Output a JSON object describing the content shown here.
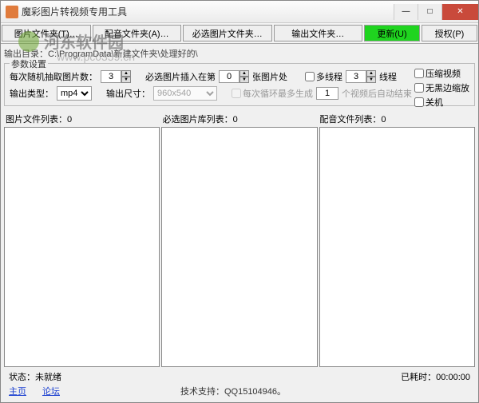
{
  "window": {
    "title": "魔彩图片转视频专用工具"
  },
  "titlebar_buttons": {
    "min": "—",
    "max": "□",
    "close": "✕"
  },
  "toolbar": {
    "btn1": "图片文件夹(T)…",
    "btn2": "配音文件夹(A)…",
    "btn3": "必选图片文件夹…",
    "btn4": "输出文件夹…",
    "btn5": "更新(U)",
    "btn6": "授权(P)"
  },
  "output_path": {
    "label": "输出目录：",
    "value": "C:\\ProgramData\\新建文件夹\\处理好的\\"
  },
  "params": {
    "legend": "参数设置",
    "row1": {
      "random_label": "每次随机抽取图片数：",
      "random_value": "3",
      "insert_label_a": "必选图片插入在第",
      "insert_value": "0",
      "insert_label_b": "张图片处",
      "multithread_label": "多线程",
      "thread_value": "3",
      "thread_label": "线程"
    },
    "row2": {
      "type_label": "输出类型：",
      "type_value": "mp4",
      "size_label": "输出尺寸：",
      "size_value": "960x540",
      "loop_label": "每次循环最多生成",
      "loop_value": "1",
      "loop_suffix": "个视频后自动结束"
    },
    "right_checks": {
      "compress": "压缩视频",
      "noblack": "无黑边缩放",
      "shutdown": "关机"
    }
  },
  "lists": {
    "h1_label": "图片文件列表：",
    "h1_count": "0",
    "h2_label": "必选图片库列表：",
    "h2_count": "0",
    "h3_label": "配音文件列表：",
    "h3_count": "0"
  },
  "status": {
    "state_label": "状态：",
    "state_value": "未就绪",
    "time_label": "已耗时：",
    "time_value": "00:00:00"
  },
  "links": {
    "home": "主页",
    "forum": "论坛",
    "tech": "技术支持：QQ15104946。"
  },
  "watermark": {
    "text": "河东软件园",
    "url": "www.pc0359.cn"
  }
}
